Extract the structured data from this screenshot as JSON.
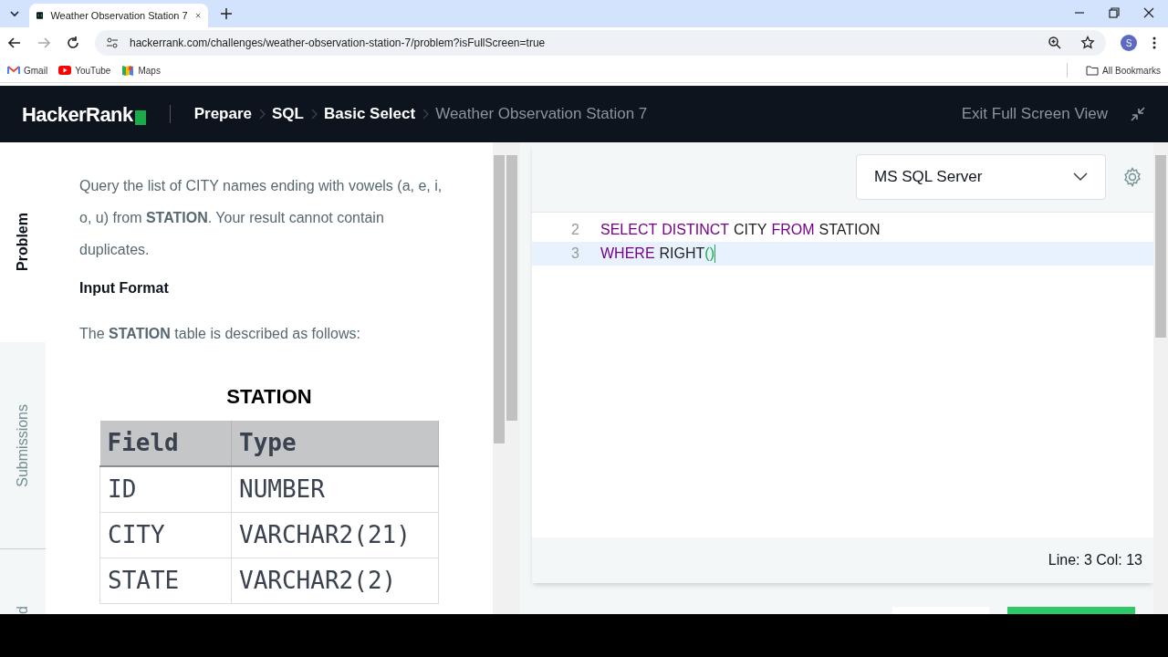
{
  "browser": {
    "tabs": [
      {
        "title": "Weather Observation Station 7",
        "selected": true
      }
    ],
    "url": "hackerrank.com/challenges/weather-observation-station-7/problem?isFullScreen=true",
    "profile_initial": "S",
    "bookmarks": [
      {
        "label": "Gmail",
        "kind": "mail"
      },
      {
        "label": "YouTube",
        "kind": "video"
      },
      {
        "label": "Maps",
        "kind": "map"
      }
    ],
    "all_bookmarks": "All Bookmarks"
  },
  "header": {
    "logo": "HackerRank",
    "breadcrumbs": [
      {
        "label": "Prepare",
        "current": false
      },
      {
        "label": "SQL",
        "current": false
      },
      {
        "label": "Basic Select",
        "current": false
      },
      {
        "label": "Weather Observation Station 7",
        "current": true
      }
    ],
    "exit": "Exit Full Screen View"
  },
  "side_tabs": [
    {
      "label": "Problem",
      "selected": true
    },
    {
      "label": "Submissions",
      "selected": false
    },
    {
      "label": "d",
      "selected": false
    }
  ],
  "problem": {
    "statement": "Query the list of CITY names ending with vowels (a, e, i, o, u) from **STATION**. Your result cannot contain duplicates.",
    "input_heading": "Input Format",
    "input_text": "The **STATION** table is described as follows:",
    "table_title": "STATION",
    "columns": [
      "Field",
      "Type"
    ],
    "rows": [
      [
        "ID",
        "NUMBER"
      ],
      [
        "CITY",
        "VARCHAR2(21)"
      ],
      [
        "STATE",
        "VARCHAR2(2)"
      ]
    ]
  },
  "editor": {
    "language": "MS SQL Server",
    "lines": [
      {
        "number": "2",
        "current": false,
        "tokens": [
          {
            "text": "SELECT",
            "kind": "keyword"
          },
          {
            "text": "DISTINCT",
            "kind": "keyword"
          },
          {
            "text": "CITY",
            "kind": "name"
          },
          {
            "text": "FROM",
            "kind": "keyword"
          },
          {
            "text": "STATION",
            "kind": "name"
          }
        ]
      },
      {
        "number": "3",
        "current": true,
        "tokens": [
          {
            "text": "WHERE",
            "kind": "keyword"
          },
          {
            "text": "RIGHT",
            "kind": "name"
          },
          {
            "text": "()",
            "kind": "bracket"
          }
        ]
      }
    ],
    "status": "Line: 3 Col: 13"
  }
}
